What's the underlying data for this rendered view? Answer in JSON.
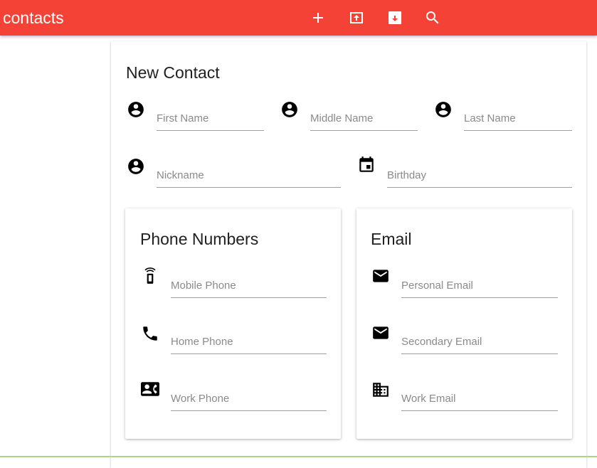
{
  "appbar": {
    "title": "contacts",
    "color": "#f44336",
    "tools": [
      {
        "icon": "add-icon"
      },
      {
        "icon": "upload-icon"
      },
      {
        "icon": "download-icon"
      },
      {
        "icon": "search-icon"
      }
    ]
  },
  "form": {
    "heading": "New Contact",
    "first_name": {
      "placeholder": "First Name",
      "value": ""
    },
    "middle_name": {
      "placeholder": "Middle Name",
      "value": ""
    },
    "last_name": {
      "placeholder": "Last Name",
      "value": ""
    },
    "nickname": {
      "placeholder": "Nickname",
      "value": ""
    },
    "birthday": {
      "placeholder": "Birthday",
      "value": ""
    }
  },
  "phone_card": {
    "title": "Phone Numbers",
    "mobile": {
      "placeholder": "Mobile Phone",
      "icon": "mobile-phone-icon"
    },
    "home": {
      "placeholder": "Home Phone",
      "icon": "phone-icon"
    },
    "work": {
      "placeholder": "Work Phone",
      "icon": "contact-phone-icon"
    }
  },
  "email_card": {
    "title": "Email",
    "personal": {
      "placeholder": "Personal Email",
      "icon": "mail-icon"
    },
    "secondary": {
      "placeholder": "Secondary Email",
      "icon": "mail-icon"
    },
    "work": {
      "placeholder": "Work Email",
      "icon": "business-icon"
    }
  }
}
